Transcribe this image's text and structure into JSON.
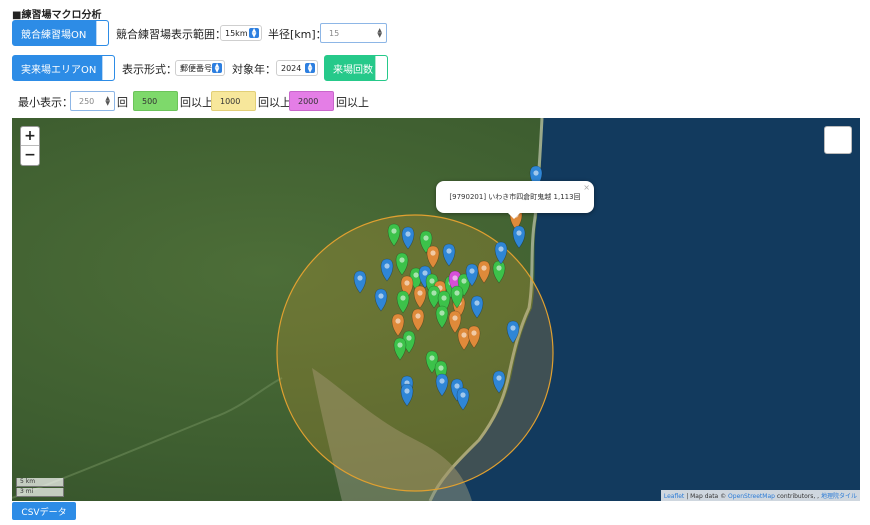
{
  "title": "■練習場マクロ分析",
  "row1": {
    "competitor_toggle": "競合練習場ON",
    "range_label": "競合練習場表示範囲：",
    "range_value": "15km",
    "radius_label": "半径[km]：",
    "radius_value": "15"
  },
  "row2": {
    "visitor_toggle": "実来場エリアON",
    "format_label": "表示形式：",
    "format_value": "郵便番号",
    "year_label": "対象年：",
    "year_value": "2024",
    "count_toggle": "来場回数"
  },
  "row3": {
    "min_label": "最小表示：",
    "min_value": "250",
    "unit1": "回",
    "t1": "500",
    "unit2": "回以上",
    "t2": "1000",
    "unit3": "回以上",
    "t3": "2000",
    "unit4": "回以上"
  },
  "map": {
    "zoom_in": "+",
    "zoom_out": "−",
    "popup_text": "[9790201] いわき市四倉町鬼越 1,113回",
    "popup_close": "×",
    "scale_km": "5 km",
    "scale_mi": "3 mi",
    "attribution_leaflet": "Leaflet",
    "attribution_text": " | Map data © ",
    "attribution_osm": "OpenStreetMap",
    "attribution_contrib": " contributors, , ",
    "attribution_gsi": "地理院タイル",
    "colors": {
      "blue": "#2f86d6",
      "green": "#3cc24a",
      "orange": "#df8a3a",
      "magenta": "#d64fd8",
      "circle": "#e0a030"
    }
  },
  "csv_button": "CSVデータ"
}
